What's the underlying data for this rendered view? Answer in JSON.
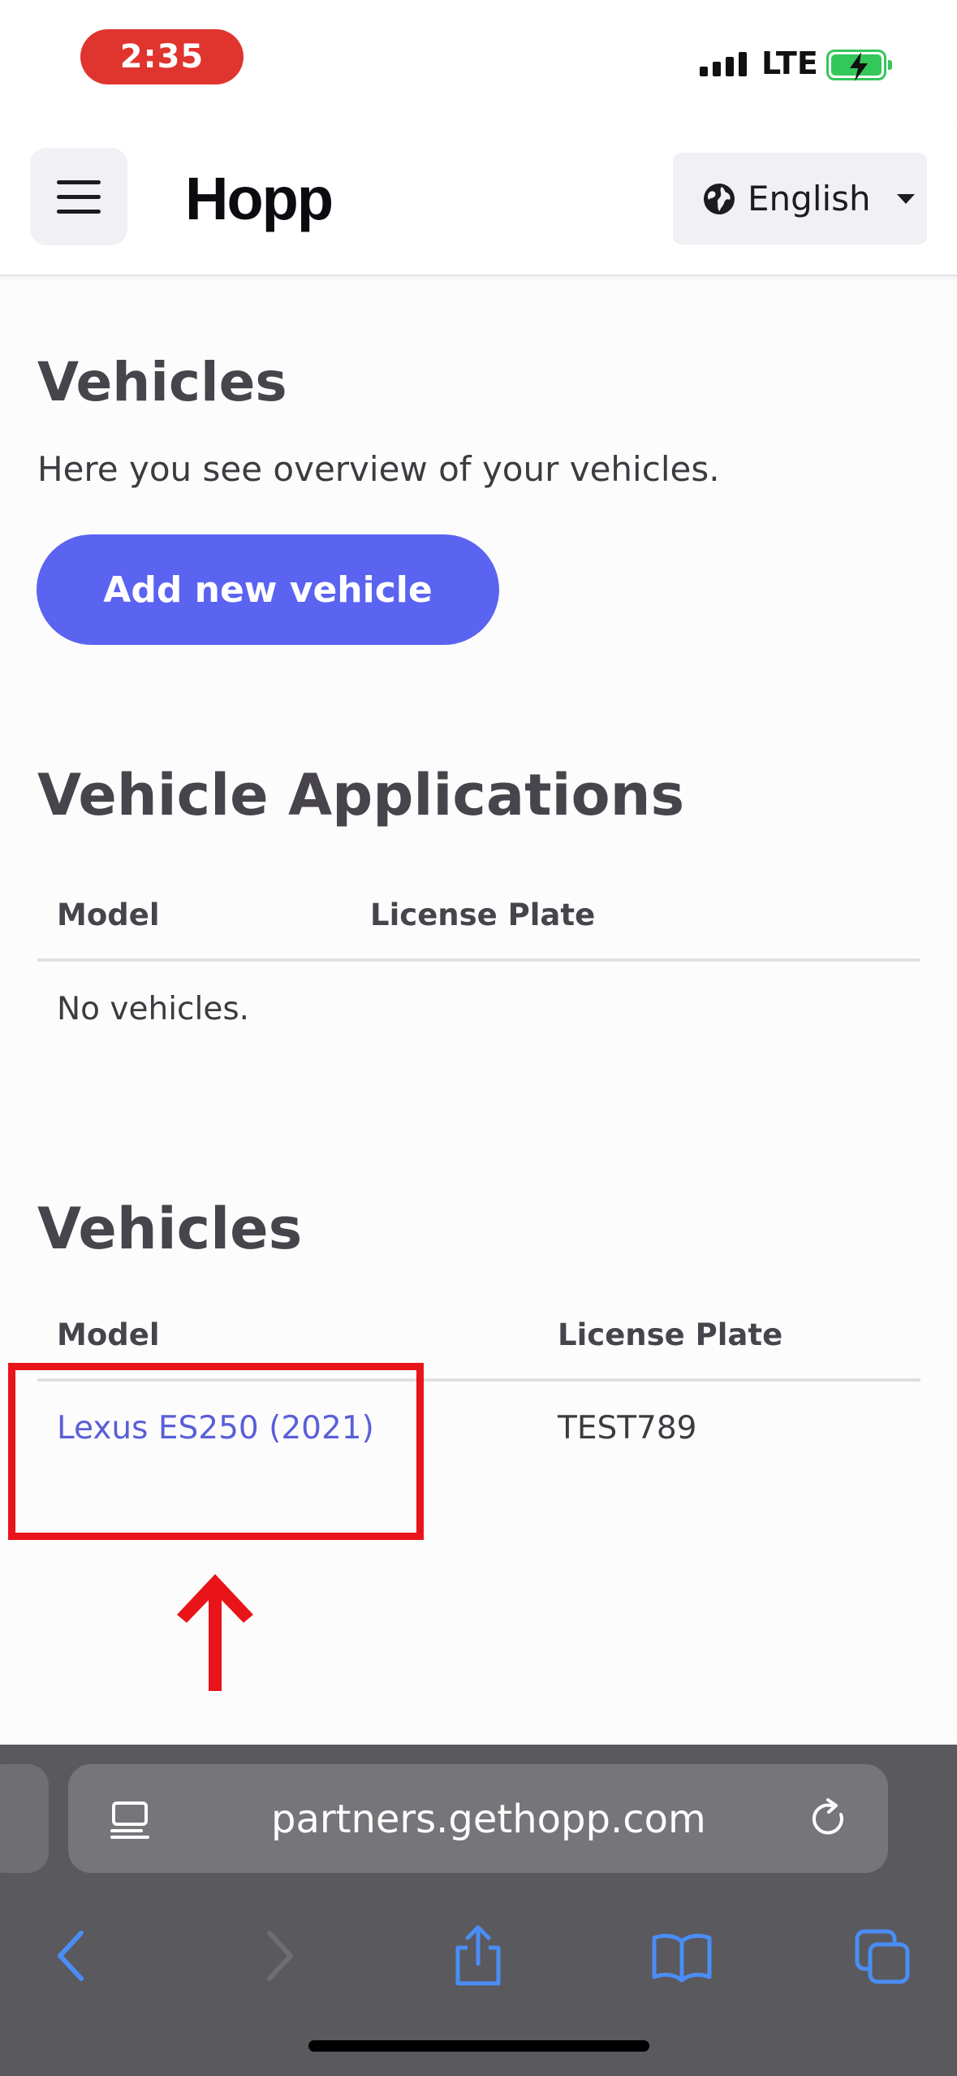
{
  "status_bar": {
    "time": "2:35",
    "network": "LTE"
  },
  "header": {
    "logo": "Hopp",
    "language": "English"
  },
  "main": {
    "title": "Vehicles",
    "subtitle": "Here you see overview of your vehicles.",
    "add_button": "Add new vehicle"
  },
  "applications": {
    "title": "Vehicle Applications",
    "columns": [
      "Model",
      "License Plate"
    ],
    "empty_text": "No vehicles."
  },
  "vehicles": {
    "title": "Vehicles",
    "columns": [
      "Model",
      "License Plate"
    ],
    "rows": [
      {
        "model": "Lexus ES250 (2021)",
        "plate": "TEST789"
      }
    ]
  },
  "browser": {
    "url": "partners.gethopp.com"
  },
  "colors": {
    "accent": "#5b63f1",
    "link": "#5a5fd8",
    "annotation": "#e8141a",
    "time_pill": "#e0342e"
  }
}
